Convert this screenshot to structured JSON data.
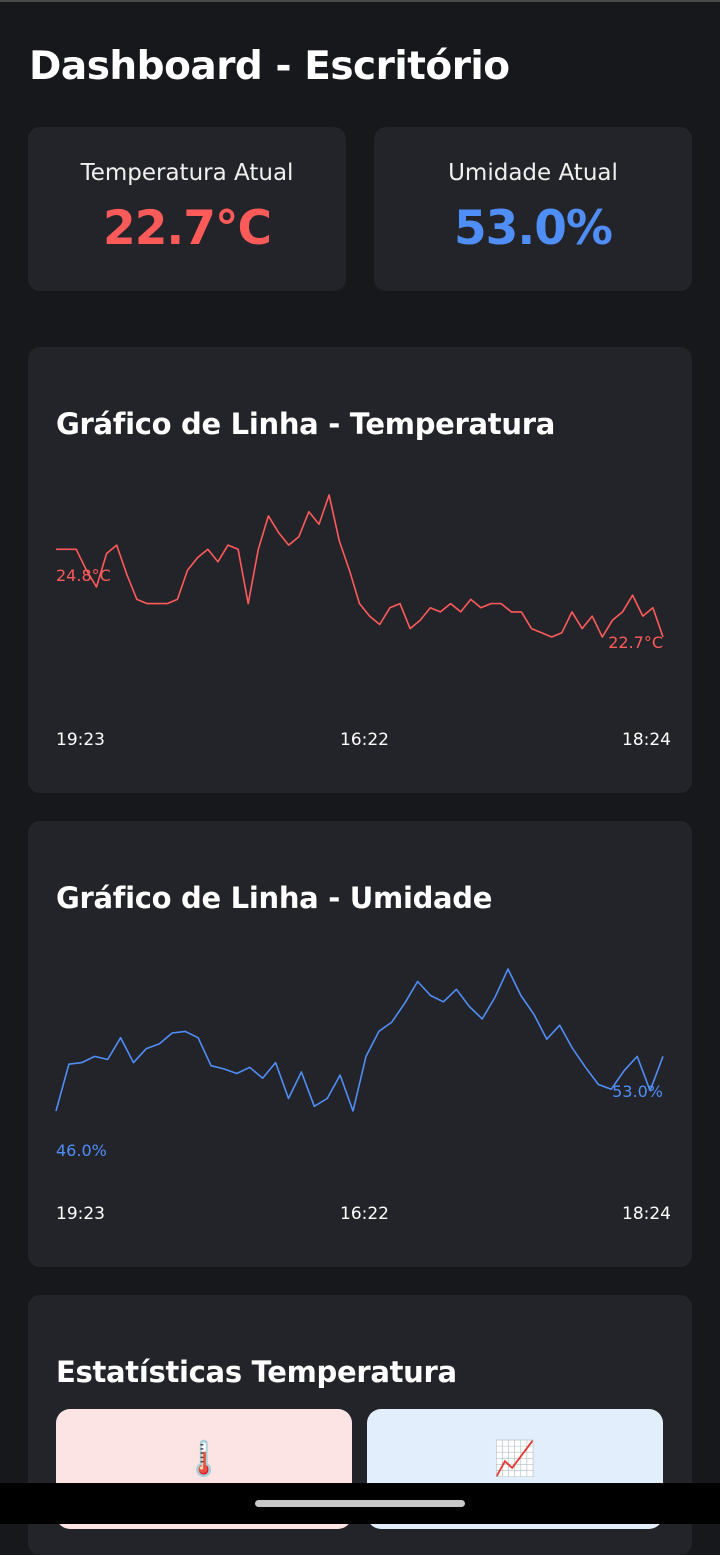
{
  "header": {
    "title": "Dashboard - Escritório"
  },
  "metrics": {
    "temperature": {
      "label": "Temperatura Atual",
      "value": "22.7°C",
      "color": "#ff5a5a"
    },
    "humidity": {
      "label": "Umidade Atual",
      "value": "53.0%",
      "color": "#4f8ef7"
    }
  },
  "temp_chart": {
    "title": "Gráfico de Linha - Temperatura",
    "start_value_label": "24.8°C",
    "end_value_label": "22.7°C",
    "x_ticks": [
      "19:23",
      "16:22",
      "18:24"
    ]
  },
  "humidity_chart": {
    "title": "Gráfico de Linha - Umidade",
    "start_value_label": "46.0%",
    "end_value_label": "53.0%",
    "x_ticks": [
      "19:23",
      "16:22",
      "18:24"
    ]
  },
  "stats": {
    "title": "Estatísticas Temperatura",
    "boxes": [
      {
        "icon": "thermometer-icon",
        "glyph": "🌡️",
        "bg": "#fde4e4"
      },
      {
        "icon": "chart-increasing-icon",
        "glyph": "📈",
        "bg": "#e3eefc"
      }
    ]
  },
  "chart_data": [
    {
      "type": "line",
      "title": "Gráfico de Linha - Temperatura",
      "x": [
        "19:23",
        "16:22",
        "18:24"
      ],
      "series": [
        {
          "color": "#ff5a5a",
          "values": [
            24.8,
            24.8,
            24.8,
            24.3,
            23.9,
            24.7,
            24.9,
            24.2,
            23.6,
            23.5,
            23.5,
            23.5,
            23.6,
            24.3,
            24.6,
            24.8,
            24.5,
            24.9,
            24.8,
            23.5,
            24.8,
            25.6,
            25.2,
            24.9,
            25.1,
            25.7,
            25.4,
            26.1,
            25.0,
            24.3,
            23.5,
            23.2,
            23.0,
            23.4,
            23.5,
            22.9,
            23.1,
            23.4,
            23.3,
            23.5,
            23.3,
            23.6,
            23.4,
            23.5,
            23.5,
            23.3,
            23.3,
            22.9,
            22.8,
            22.7,
            22.8,
            23.3,
            22.9,
            23.2,
            22.7,
            23.1,
            23.3,
            23.7,
            23.2,
            23.4,
            22.7
          ]
        }
      ]
    },
    {
      "type": "line",
      "title": "Gráfico de Linha - Umidade",
      "x": [
        "19:23",
        "16:22",
        "18:24"
      ],
      "series": [
        {
          "color": "#4f8ef7",
          "values": [
            49.5,
            52.5,
            52.6,
            53.0,
            52.8,
            54.2,
            52.6,
            53.5,
            53.8,
            54.5,
            54.6,
            54.2,
            52.4,
            52.2,
            51.9,
            52.3,
            51.6,
            52.6,
            50.3,
            52.0,
            49.8,
            50.3,
            51.8,
            49.5,
            53.0,
            54.6,
            55.2,
            56.4,
            57.8,
            56.9,
            56.5,
            57.3,
            56.2,
            55.4,
            56.8,
            58.6,
            56.9,
            55.7,
            54.1,
            55.0,
            53.5,
            52.3,
            51.2,
            50.9,
            52.1,
            53.0,
            50.8,
            53.0
          ]
        }
      ]
    }
  ]
}
